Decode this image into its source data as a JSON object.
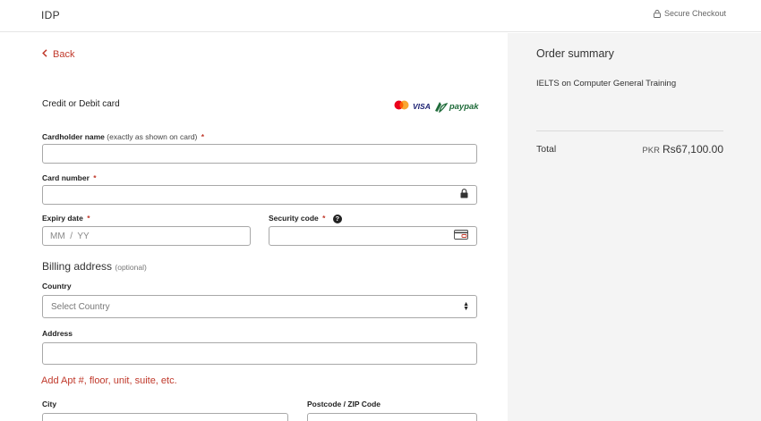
{
  "header": {
    "brand": "IDP",
    "secure_checkout": "Secure Checkout",
    "lock_icon": "lock-icon"
  },
  "nav": {
    "back_label": "Back",
    "back_icon": "chevron-left-icon"
  },
  "payment": {
    "title": "Credit or Debit card",
    "brands": [
      "mastercard-logo",
      "VISA",
      "paypak"
    ],
    "cardholder": {
      "label": "Cardholder name",
      "hint": "(exactly as shown on card)",
      "required": "*",
      "value": ""
    },
    "card_number": {
      "label": "Card number",
      "required": "*",
      "value": "",
      "icon": "lock-icon"
    },
    "expiry": {
      "label": "Expiry date",
      "required": "*",
      "placeholder": "MM  /  YY"
    },
    "security": {
      "label": "Security code",
      "required": "*",
      "help": "?",
      "icon": "card-cvv-icon"
    }
  },
  "billing": {
    "title": "Billing address",
    "optional": "(optional)",
    "country": {
      "label": "Country",
      "value": "Select Country",
      "icon": "sort-arrows-icon"
    },
    "address": {
      "label": "Address",
      "value": ""
    },
    "add_apt_link": "Add Apt #, floor, unit, suite, etc.",
    "city": {
      "label": "City"
    },
    "postcode": {
      "label": "Postcode / ZIP Code"
    }
  },
  "summary": {
    "title": "Order summary",
    "item": "IELTS on Computer General Training",
    "total_label": "Total",
    "total_currency": "PKR",
    "total_value": "Rs67,100.00"
  },
  "colors": {
    "accent": "#c0392b",
    "summary_bg": "#f4f4f4",
    "border": "#a8a8a8"
  }
}
